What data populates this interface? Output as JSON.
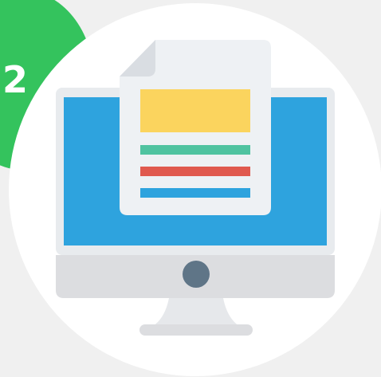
{
  "step_badge": {
    "number": "2",
    "color": "#34c35d"
  },
  "icon": {
    "name": "computer-document-icon",
    "circle_color": "#ffffff",
    "screen_color": "#2ea3de",
    "bezel_color": "#e8ebee",
    "chin_color": "#dcdde0",
    "stand_color": "#e6e8eb",
    "button_color": "#5f7587",
    "document_color": "#eef1f4",
    "document_fold_color": "#d9dde2",
    "document_block_color": "#fbd45e",
    "document_lines": [
      "#4fc3a0",
      "#e0594e",
      "#2ea3de"
    ]
  }
}
